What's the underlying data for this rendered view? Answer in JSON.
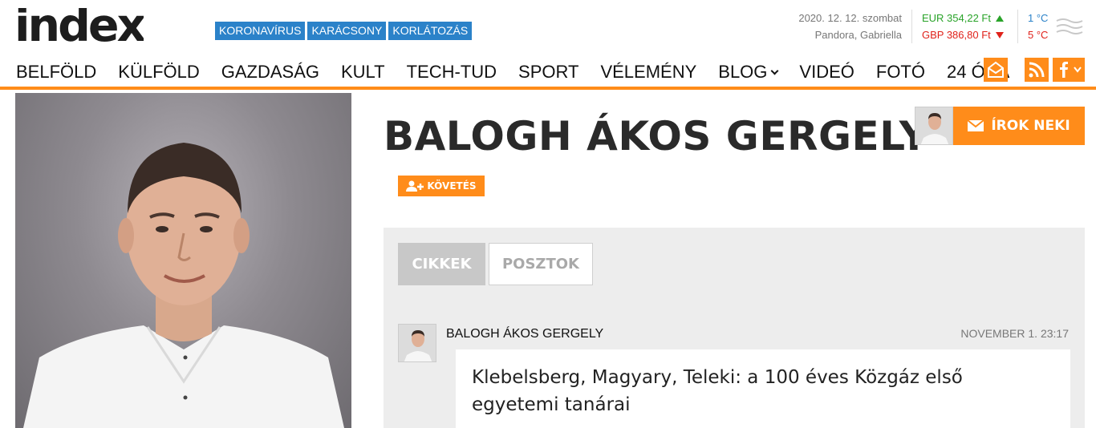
{
  "site": {
    "logo": "index"
  },
  "hot_tags": [
    "KORONAVÍRUS",
    "KARÁCSONY",
    "KORLÁTOZÁS"
  ],
  "date_info": {
    "date": "2020. 12. 12. szombat",
    "name_day": "Pandora, Gabriella"
  },
  "fx": {
    "eur": "EUR 354,22 Ft",
    "gbp": "GBP 386,80 Ft"
  },
  "weather": {
    "min": "1 °C",
    "max": "5 °C",
    "icon": "fog-icon"
  },
  "nav": [
    "BELFÖLD",
    "KÜLFÖLD",
    "GAZDASÁG",
    "KULT",
    "TECH-TUD",
    "SPORT",
    "VÉLEMÉNY",
    "BLOG",
    "VIDEÓ",
    "FOTÓ",
    "24 ÓRA"
  ],
  "social": [
    "newsletter-icon",
    "rss-icon",
    "facebook-icon"
  ],
  "author": {
    "name": "BALOGH ÁKOS GERGELY",
    "write_label": "ÍROK NEKI",
    "follow_label": "KÖVETÉS"
  },
  "tabs": {
    "active": "CIKKEK",
    "inactive": "POSZTOK"
  },
  "entry": {
    "author": "BALOGH ÁKOS GERGELY",
    "date": "NOVEMBER 1. 23:17",
    "title": "Klebelsberg, Magyary, Teleki: a 100 éves Közgáz első egyetemi tanárai"
  },
  "colors": {
    "accent": "#ff8c1a",
    "tag_blue": "#2b82c9",
    "fx_up": "#29a329",
    "fx_down": "#e0221b"
  }
}
